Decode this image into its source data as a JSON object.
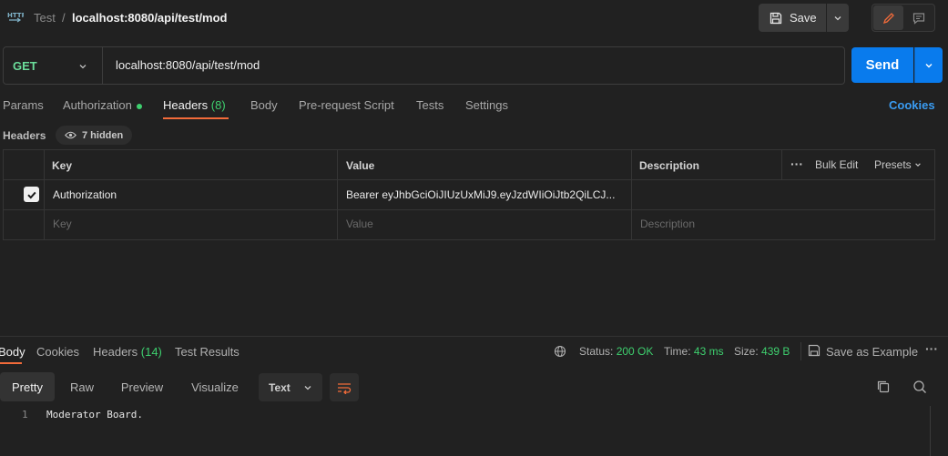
{
  "breadcrumb": {
    "parent": "Test",
    "separator": "/",
    "current": "localhost:8080/api/test/mod"
  },
  "toolbar": {
    "save_label": "Save"
  },
  "request": {
    "method": "GET",
    "url": "localhost:8080/api/test/mod",
    "send_label": "Send"
  },
  "request_tabs": {
    "params": "Params",
    "authorization": "Authorization",
    "headers": "Headers",
    "headers_count": "(8)",
    "body": "Body",
    "pre_request": "Pre-request Script",
    "tests": "Tests",
    "settings": "Settings",
    "cookies": "Cookies"
  },
  "headers_section": {
    "label": "Headers",
    "hidden": "7 hidden"
  },
  "table": {
    "columns": {
      "key": "Key",
      "value": "Value",
      "description": "Description"
    },
    "bulk_edit": "Bulk Edit",
    "presets": "Presets",
    "rows": [
      {
        "checked": true,
        "key": "Authorization",
        "value": "Bearer eyJhbGciOiJIUzUxMiJ9.eyJzdWIiOiJtb2QiLCJ..."
      }
    ],
    "placeholder": {
      "key": "Key",
      "value": "Value",
      "description": "Description"
    }
  },
  "response": {
    "tabs": {
      "body": "Body",
      "cookies": "Cookies",
      "headers": "Headers",
      "headers_count": "(14)",
      "test_results": "Test Results"
    },
    "status_label": "Status:",
    "status_value": "200 OK",
    "time_label": "Time:",
    "time_value": "43 ms",
    "size_label": "Size:",
    "size_value": "439 B",
    "save_example": "Save as Example",
    "formats": {
      "pretty": "Pretty",
      "raw": "Raw",
      "preview": "Preview",
      "visualize": "Visualize"
    },
    "type_select": "Text",
    "line_number": "1",
    "body_text": "Moderator Board."
  },
  "colors": {
    "accent": "#f26b3a",
    "send": "#097bed",
    "success": "#3ecf6e",
    "method_get": "#6bdd9a",
    "link": "#3a9cf2"
  }
}
